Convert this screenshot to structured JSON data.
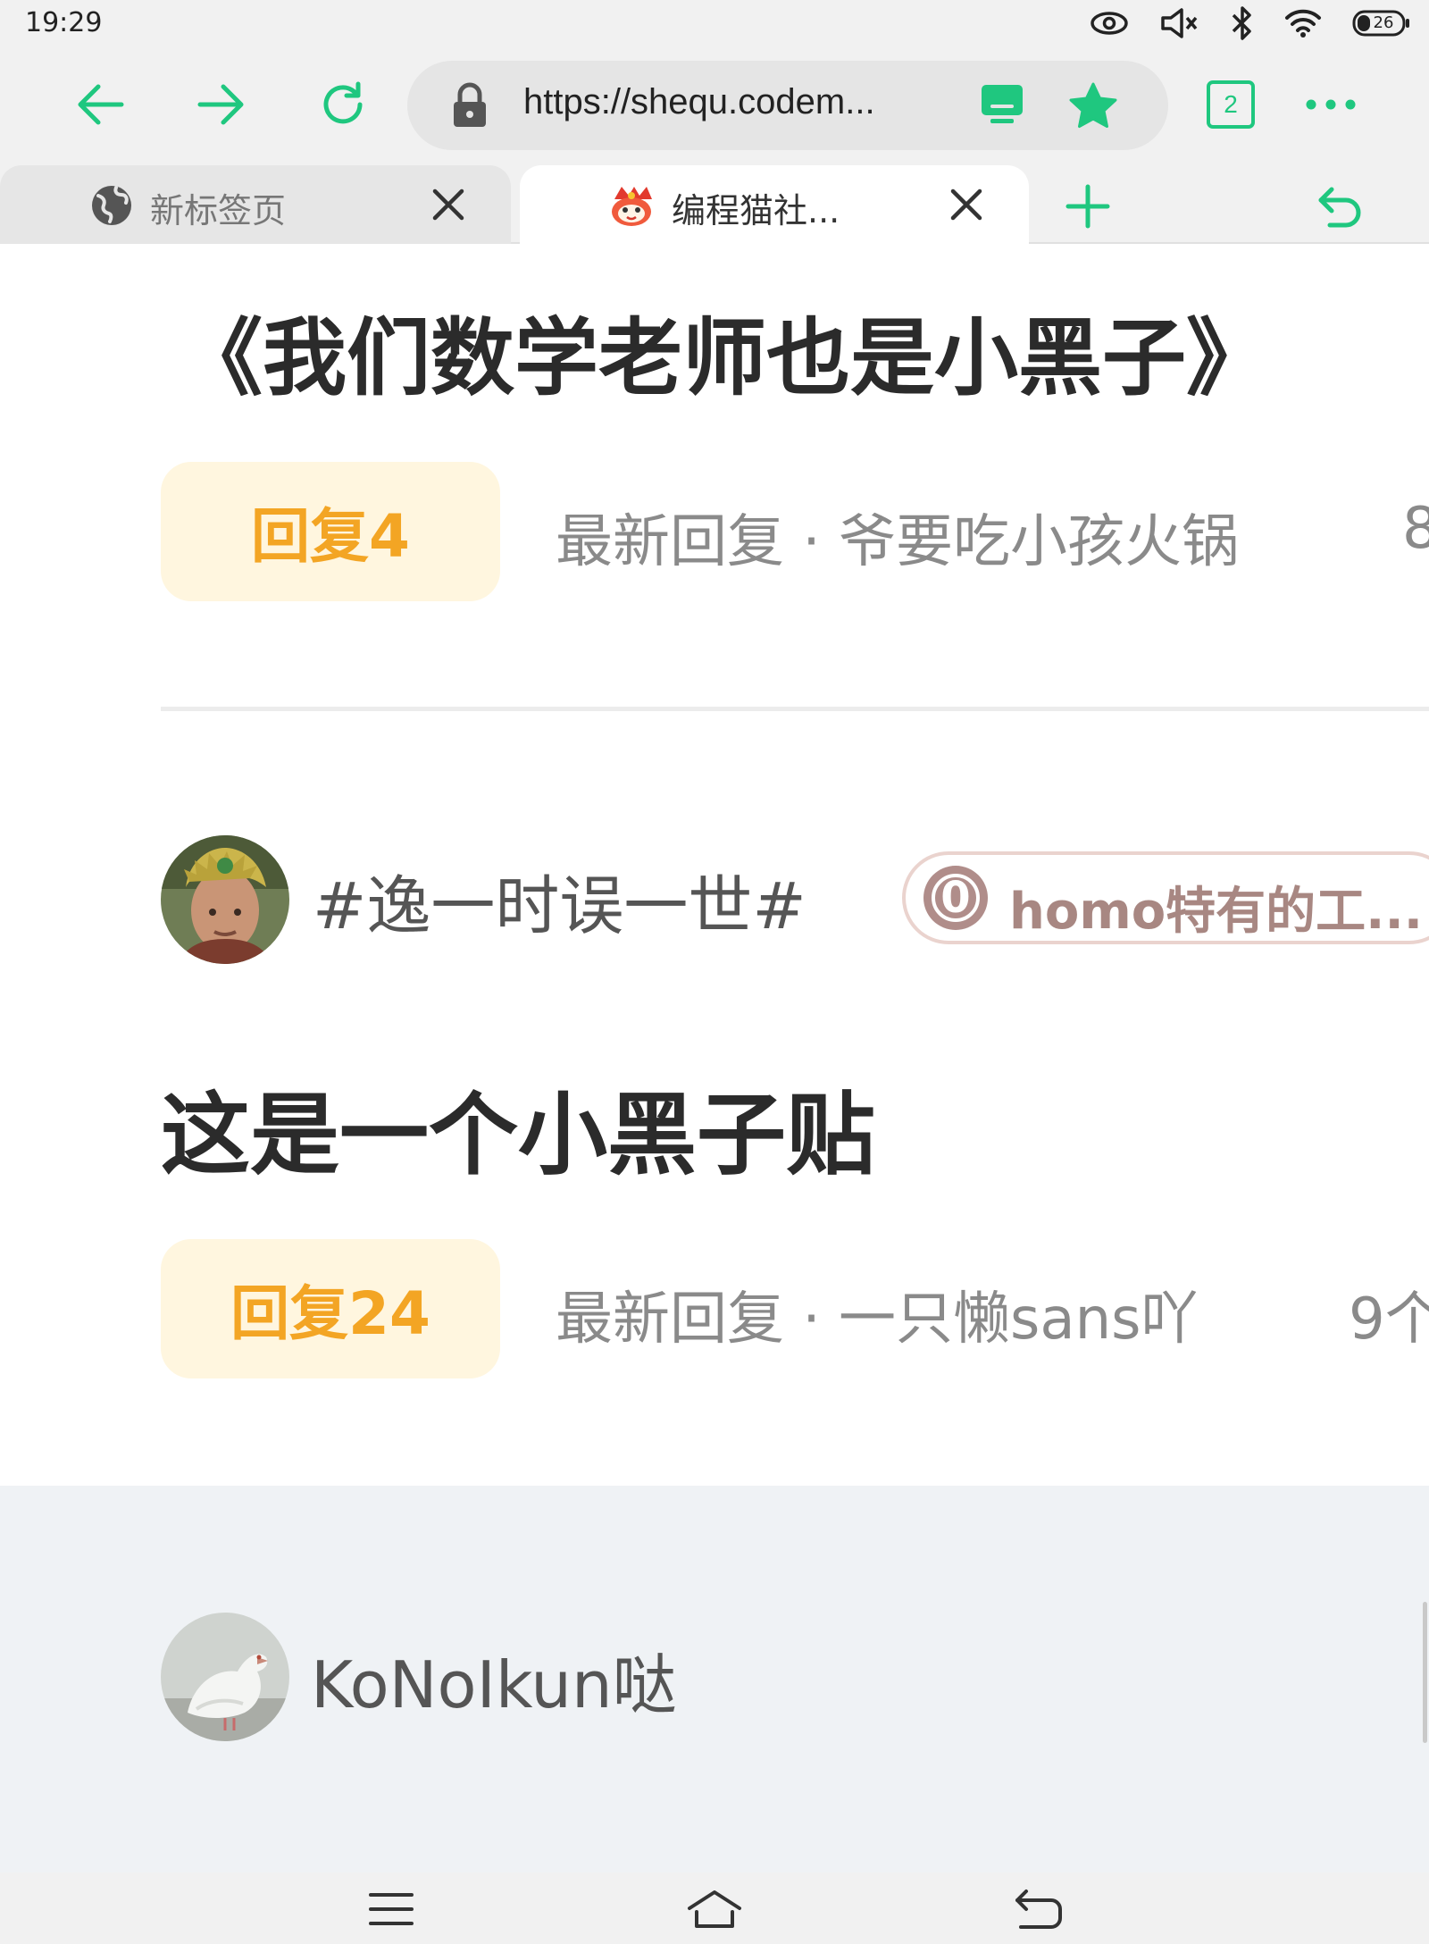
{
  "status_bar": {
    "time": "19:29",
    "battery_level": "26",
    "icons": [
      "eye-icon",
      "mute-icon",
      "bluetooth-icon",
      "wifi-icon",
      "battery-icon"
    ]
  },
  "toolbar": {
    "url": "https://shequ.codem...",
    "tab_count": "2",
    "accent_color": "#1fc77f"
  },
  "tabs": [
    {
      "title": "新标签页",
      "active": false
    },
    {
      "title": "编程猫社...",
      "active": true
    }
  ],
  "posts": [
    {
      "title": "《我们数学老师也是小黑子》",
      "reply_label": "回复4",
      "latest_reply": "最新回复 · 爷要吃小孩火锅",
      "extra": "8"
    },
    {
      "author": "#逸一时误一世#",
      "tag_number": "0",
      "tag_text": "homo特有的工...",
      "title": "这是一个小黑子贴",
      "reply_label": "回复24",
      "latest_reply": "最新回复 · 一只懒sans吖",
      "extra": "9个"
    },
    {
      "author": "KoNoIkun哒"
    }
  ]
}
